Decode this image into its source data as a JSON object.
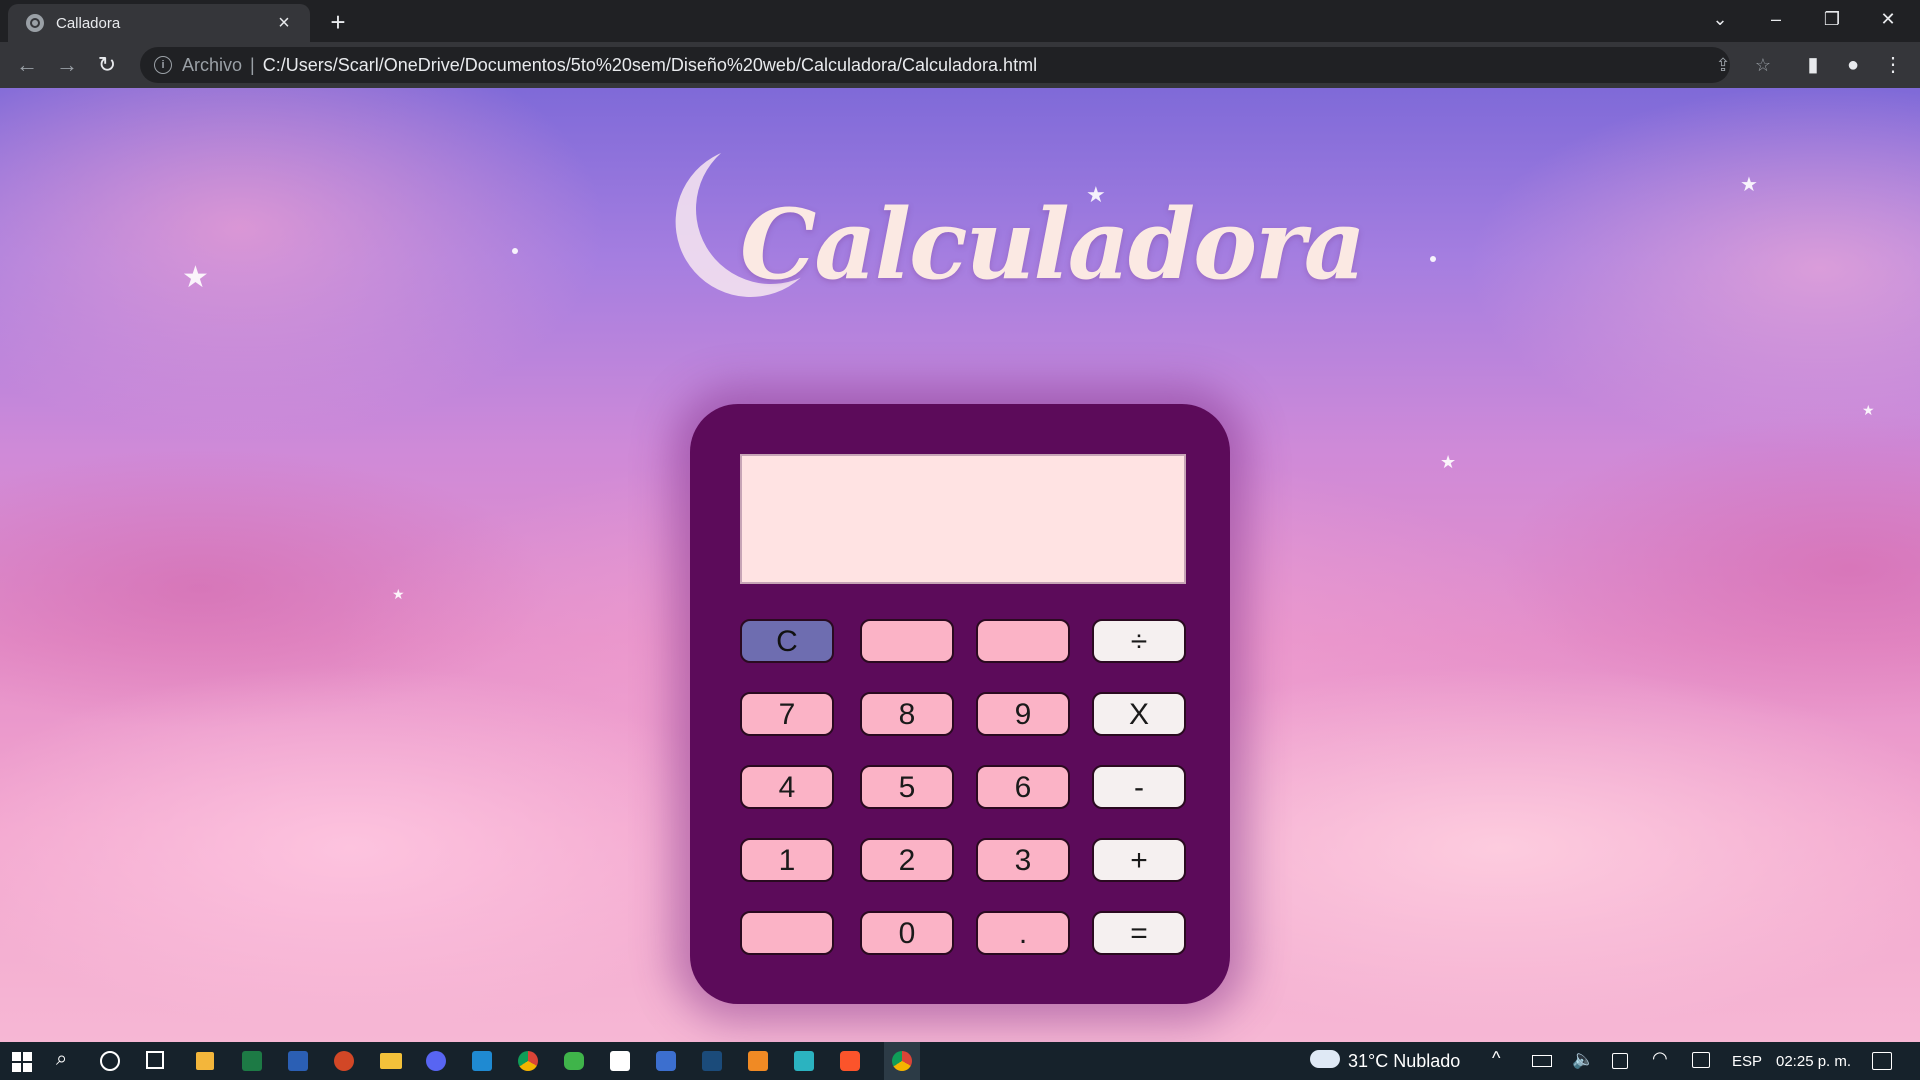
{
  "browser": {
    "tab_title": "Calladora",
    "new_tab_symbol": "+",
    "scheme_label": "Archivo",
    "url": "C:/Users/Scarl/OneDrive/Documentos/5to%20sem/Diseño%20web/Calculadora/Calculadora.html"
  },
  "page": {
    "title": "Calculadora",
    "display_value": ""
  },
  "keypad": {
    "rows": [
      [
        {
          "label": "C",
          "kind": "clear"
        },
        {
          "label": "",
          "kind": "num"
        },
        {
          "label": "",
          "kind": "num"
        },
        {
          "label": "÷",
          "kind": "op"
        }
      ],
      [
        {
          "label": "7",
          "kind": "num"
        },
        {
          "label": "8",
          "kind": "num"
        },
        {
          "label": "9",
          "kind": "num"
        },
        {
          "label": "X",
          "kind": "op"
        }
      ],
      [
        {
          "label": "4",
          "kind": "num"
        },
        {
          "label": "5",
          "kind": "num"
        },
        {
          "label": "6",
          "kind": "num"
        },
        {
          "label": "-",
          "kind": "op"
        }
      ],
      [
        {
          "label": "1",
          "kind": "num"
        },
        {
          "label": "2",
          "kind": "num"
        },
        {
          "label": "3",
          "kind": "num"
        },
        {
          "label": "+",
          "kind": "op"
        }
      ],
      [
        {
          "label": "",
          "kind": "num"
        },
        {
          "label": "0",
          "kind": "num"
        },
        {
          "label": ".",
          "kind": "num"
        },
        {
          "label": "=",
          "kind": "op"
        }
      ]
    ]
  },
  "taskbar": {
    "weather": "31°C Nublado",
    "language": "ESP",
    "time": "02:25 p. m."
  },
  "colors": {
    "calculator_body": "#5c0b5a",
    "display_bg": "#ffe3e3",
    "key_pink": "#fbb3c6",
    "key_clear": "#6e6db0",
    "key_operator": "#f5f0f0"
  }
}
